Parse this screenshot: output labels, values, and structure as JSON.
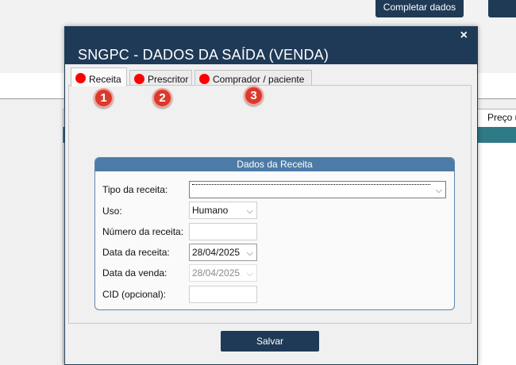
{
  "app": {
    "top_button_label": "Completar dados",
    "column_header": "Preço u"
  },
  "dialog": {
    "title": "SNGPC - DADOS DA SAÍDA (VENDA)",
    "close_label": "×",
    "tabs": [
      {
        "label": "Receita",
        "status_color": "#ff0000",
        "active": true
      },
      {
        "label": "Prescritor",
        "status_color": "#ff0000",
        "active": false
      },
      {
        "label": "Comprador / paciente",
        "status_color": "#ff0000",
        "active": false
      }
    ],
    "badges": [
      "1",
      "2",
      "3"
    ],
    "group_title": "Dados da Receita",
    "form": {
      "tipo_label": "Tipo da receita:",
      "tipo_value": "",
      "uso_label": "Uso:",
      "uso_value": "Humano",
      "numero_label": "Número da receita:",
      "numero_value": "",
      "data_receita_label": "Data da receita:",
      "data_receita_value": "28/04/2025",
      "data_venda_label": "Data da venda:",
      "data_venda_value": "28/04/2025",
      "cid_label": "CID (opcional):",
      "cid_value": ""
    },
    "save_label": "Salvar"
  },
  "colors": {
    "titlebar": "#1f3a57",
    "group_header": "#4d7ba7",
    "tab_status": "#ff0000",
    "badge": "#d93a2e",
    "teal_row": "#2f7a87"
  }
}
